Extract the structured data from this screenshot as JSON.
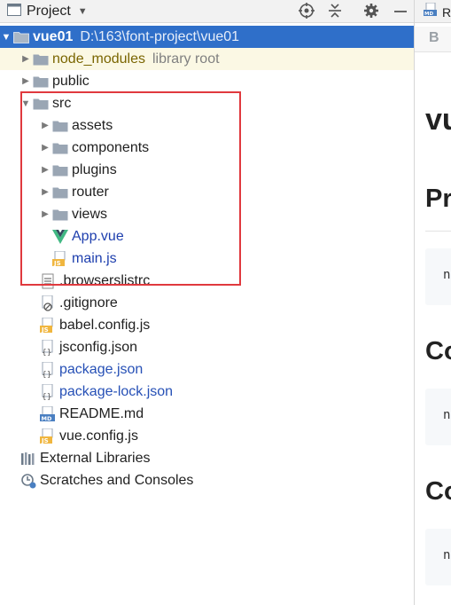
{
  "toolbar": {
    "title": "Project",
    "dropdown_glyph": "▼",
    "icons": [
      "target-icon",
      "collapse-icon",
      "gear-icon",
      "minimize-icon"
    ]
  },
  "tree": {
    "root": {
      "label": "vue01",
      "path": "D:\\163\\font-project\\vue01"
    },
    "node_modules": {
      "label": "node_modules",
      "hint": "library root"
    },
    "public": {
      "label": "public"
    },
    "src": {
      "label": "src",
      "children": {
        "assets": "assets",
        "components": "components",
        "plugins": "plugins",
        "router": "router",
        "views": "views",
        "app_vue": "App.vue",
        "main_js": "main.js"
      }
    },
    "files": {
      "browserslistrc": ".browserslistrc",
      "gitignore": ".gitignore",
      "babel_config": "babel.config.js",
      "jsconfig": "jsconfig.json",
      "package_json": "package.json",
      "package_lock": "package-lock.json",
      "readme": "README.md",
      "vue_config": "vue.config.js"
    },
    "external_libraries": "External Libraries",
    "scratches": "Scratches and Consoles"
  },
  "editor": {
    "tab_label": "R",
    "tab_icon_text": "MD",
    "toolbar_bold": "B",
    "heading1": "vu",
    "heading2a": "Pr",
    "heading2b": "Co",
    "heading2c": "Co",
    "code_text": "n"
  },
  "colors": {
    "selection": "#2f6fc9",
    "highlight_box": "#e0393e",
    "vcs_modified": "#1e3fae",
    "excluded_bg": "#fbf8e4",
    "folder": "#8f9aa8"
  }
}
